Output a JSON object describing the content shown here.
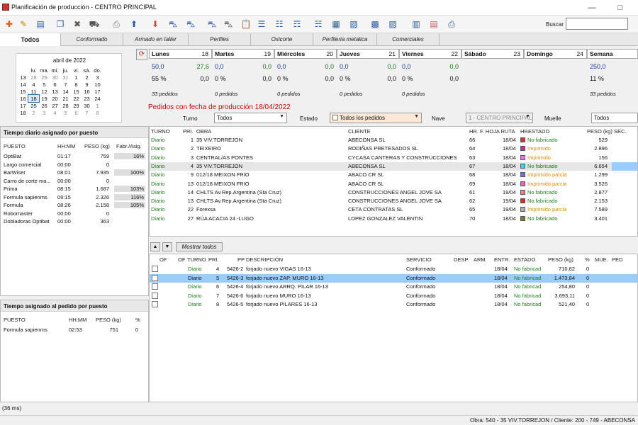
{
  "window": {
    "title": "Planificación de producción - CENTRO PRINCIPAL",
    "minimize": "—",
    "maximize": "□",
    "close": "✕"
  },
  "toolbar": {
    "icons": [
      "add-icon",
      "edit-icon",
      "book-icon",
      "copy-icon",
      "delete-icon",
      "truck-icon",
      "print-icon",
      "up-icon",
      "down-icon",
      "car-add-icon",
      "car-remove-icon",
      "car-cut-icon",
      "car-icon",
      "clipboard-icon",
      "list-icon",
      "list-edit-icon",
      "list-copy-icon",
      "list-new-icon",
      "doc-icon",
      "doc-alt-icon",
      "grid-icon",
      "grid-alt-icon",
      "report-icon",
      "report-alt-icon",
      "report-print-icon"
    ],
    "search_label": "Buscar",
    "search_value": ""
  },
  "tabs": [
    "Todos",
    "Conformado",
    "Armado en taller",
    "Perfiles",
    "Oxicorte",
    "Perfileria metalica",
    "Comerciales"
  ],
  "calendar": {
    "month": "abril de 2022",
    "weekdays": [
      "lu.",
      "ma.",
      "mi.",
      "ju.",
      "vi.",
      "sá.",
      "do."
    ],
    "weeks": [
      [
        "13",
        "28",
        "29",
        "30",
        "31",
        "1",
        "2",
        "3"
      ],
      [
        "14",
        "4",
        "5",
        "6",
        "7",
        "8",
        "9",
        "10"
      ],
      [
        "15",
        "11",
        "12",
        "13",
        "14",
        "15",
        "16",
        "17"
      ],
      [
        "16",
        "18",
        "19",
        "20",
        "21",
        "22",
        "23",
        "24"
      ],
      [
        "17",
        "25",
        "26",
        "27",
        "28",
        "29",
        "30",
        "1"
      ],
      [
        "18",
        "2",
        "3",
        "4",
        "5",
        "6",
        "7",
        "8"
      ]
    ]
  },
  "week": {
    "days": [
      {
        "name": "Lunes",
        "num": "18",
        "weight": "50,0",
        "val": "27,6",
        "extra": "",
        "pct": "55 %",
        "pct_val": "0,0",
        "orders": "33 pedidos"
      },
      {
        "name": "Martes",
        "num": "19",
        "weight": "0,0",
        "val": "0,0",
        "extra": "",
        "pct": "0 %",
        "pct_val": "0,0",
        "orders": "0 pedidos"
      },
      {
        "name": "Miércoles",
        "num": "20",
        "weight": "0,0",
        "val": "0,0",
        "extra": "",
        "pct": "0 %",
        "pct_val": "0,0",
        "orders": "0 pedidos"
      },
      {
        "name": "Jueves",
        "num": "21",
        "weight": "0,0",
        "val": "0,0",
        "extra": "",
        "pct": "0 %",
        "pct_val": "0,0",
        "orders": "0 pedidos"
      },
      {
        "name": "Viernes",
        "num": "22",
        "weight": "0,0",
        "val": "0,0",
        "extra": "",
        "pct": "0 %",
        "pct_val": "0,0",
        "orders": "0 pedidos"
      },
      {
        "name": "Sábado",
        "num": "23",
        "weight": "",
        "val": "",
        "extra": "",
        "pct": "",
        "pct_val": "",
        "orders": ""
      },
      {
        "name": "Domingo",
        "num": "24",
        "weight": "",
        "val": "",
        "extra": "",
        "pct": "",
        "pct_val": "",
        "orders": ""
      },
      {
        "name": "Semana",
        "num": "",
        "weight": "250,0",
        "val": "",
        "extra": "",
        "pct": "11 %",
        "pct_val": "",
        "orders": "33 pedidos"
      }
    ]
  },
  "orders_section": {
    "title": "Pedidos con fecha de producción 18/04/2022",
    "turno_label": "Turno",
    "turno_value": "Todos",
    "estado_label": "Estado",
    "estado_value": "Todos los pedidos",
    "nave_label": "Nave",
    "nave_value": "1 - CENTRO PRINCIPAL",
    "muelle_label": "Muelle",
    "muelle_value": "Todos"
  },
  "colors": {
    "green": "#1c7c1c",
    "orange": "#e08a00",
    "blue": "#1a3d9a",
    "red": "#c00000"
  },
  "orders": {
    "headers": [
      "TURNO",
      "PRI.",
      "OBRA",
      "CLIENTE",
      "HR.",
      "F. HOJA RUTA",
      "HR.",
      "ESTADO",
      "PESO (kg)",
      "SEC."
    ],
    "rows": [
      {
        "turno": "Diario",
        "pri": "1",
        "obra": "35 VIV.TORREJON",
        "cliente": "ABECONSA SL",
        "hr": "66",
        "fecha": "18/04",
        "color": "#e03030",
        "estado": "No fabricado",
        "peso": "529",
        "st": "green"
      },
      {
        "turno": "Diario",
        "pri": "2",
        "obra": "TEIXEIRO",
        "cliente": "RODIÑAS PRETESADOS SL",
        "hr": "64",
        "fecha": "18/04",
        "color": "#e02090",
        "estado": "Imprimido",
        "peso": "2.896",
        "st": "orange"
      },
      {
        "turno": "Diario",
        "pri": "3",
        "obra": "CENTRAL/AS PONTES",
        "cliente": "CYCASA CANTERAS Y CONSTRUCCIONES",
        "hr": "63",
        "fecha": "18/04",
        "color": "#f070f0",
        "estado": "Imprimido",
        "peso": "156",
        "st": "orange"
      },
      {
        "turno": "Diario",
        "pri": "4",
        "obra": "35 VIV.TORREJON",
        "cliente": "ABECONSA SL",
        "hr": "67",
        "fecha": "18/04",
        "color": "#20e0f0",
        "estado": "No fabricado",
        "peso": "6.654",
        "st": "green"
      },
      {
        "turno": "Diario",
        "pri": "9",
        "obra": "012/18 MEIXON FRIO",
        "cliente": "ABACO CR SL",
        "hr": "68",
        "fecha": "18/04",
        "color": "#7070e0",
        "estado": "Imprimido parcia",
        "peso": "1.299",
        "st": "orange"
      },
      {
        "turno": "Diario",
        "pri": "13",
        "obra": "012/18 MEIXON FRIO",
        "cliente": "ABACO CR SL",
        "hr": "69",
        "fecha": "18/04",
        "color": "#f060c0",
        "estado": "Imprimido parcia",
        "peso": "3.526",
        "st": "orange"
      },
      {
        "turno": "Diario",
        "pri": "14",
        "obra": "CHLTS Av.Rep.Argentina (Sta Cruz)",
        "cliente": "CONSTRUCCIONES ANGEL JOVE SA",
        "hr": "61",
        "fecha": "19/04",
        "color": "#f08090",
        "estado": "No fabricado",
        "peso": "2.877",
        "st": "green"
      },
      {
        "turno": "Diario",
        "pri": "13",
        "obra": "CHLTS Av.Rep.Argentina (Sta Cruz)",
        "cliente": "CONSTRUCCIONES ANGEL JOVE SA",
        "hr": "62",
        "fecha": "19/04",
        "color": "#f02020",
        "estado": "No fabricado",
        "peso": "2.153",
        "st": "green"
      },
      {
        "turno": "Diario",
        "pri": "22",
        "obra": "Forexsa",
        "cliente": "CETA CONTRATAS SL",
        "hr": "65",
        "fecha": "19/04",
        "color": "#b0b0b0",
        "estado": "Imprimido parcia",
        "peso": "7.589",
        "st": "orange"
      },
      {
        "turno": "Diario",
        "pri": "27",
        "obra": "RÚA ACACIA 24 -LUGO",
        "cliente": "LOPEZ GONZALEZ VALENTIN",
        "hr": "70",
        "fecha": "18/04",
        "color": "#808020",
        "estado": "No fabricado",
        "peso": "3.401",
        "st": "green"
      }
    ]
  },
  "left_top": {
    "title": "Tiempo diario asignado por puesto",
    "headers": [
      "PUESTO",
      "HH:MM",
      "PESO (kg)",
      "Fabr./Asig."
    ],
    "rows": [
      {
        "puesto": "OptiBat",
        "hh": "01:17",
        "peso": "759",
        "pct": "16%"
      },
      {
        "puesto": "Largo comercial",
        "hh": "00:00",
        "peso": "0",
        "pct": ""
      },
      {
        "puesto": "BarWiser",
        "hh": "08:01",
        "peso": "7.935",
        "pct": "100%"
      },
      {
        "puesto": "Carro de corte ma...",
        "hh": "00:00",
        "peso": "0",
        "pct": ""
      },
      {
        "puesto": "Prima",
        "hh": "08:15",
        "peso": "1.687",
        "pct": "103%"
      },
      {
        "puesto": "Formula sapienms",
        "hh": "09:15",
        "peso": "2.326",
        "pct": "116%"
      },
      {
        "puesto": "Formula",
        "hh": "08:26",
        "peso": "2.158",
        "pct": "105%"
      },
      {
        "puesto": "Robomaster",
        "hh": "00:00",
        "peso": "0",
        "pct": ""
      },
      {
        "puesto": "Dobladoras Optibat",
        "hh": "00:00",
        "peso": "363",
        "pct": ""
      }
    ]
  },
  "left_bottom": {
    "title": "Tiempo asignado al pedido por puesto",
    "headers": [
      "PUESTO",
      "HH:MM",
      "PESO (kg)",
      "%"
    ],
    "rows": [
      {
        "puesto": "Formula sapienms",
        "hh": "02:53",
        "peso": "751",
        "pct": "0"
      }
    ]
  },
  "detail": {
    "up": "▲",
    "down": "▼",
    "mostrar": "Mostrar todos",
    "headers": [
      "OF",
      "OF",
      "TURNO",
      "PRI.",
      "PP",
      "DESCRIPCIÓN",
      "SERVICIO",
      "DESP.",
      "ARM.",
      "ENTR.",
      "ESTADO",
      "PESO (kg)",
      "%",
      "MUE.",
      "PED"
    ],
    "rows": [
      {
        "turno": "Diario",
        "pri": "4",
        "pp": "5426-2",
        "desc": "forjado nuevo VIGAS 16-13",
        "servicio": "Conformado",
        "entr": "18/04",
        "estado": "No fabricad",
        "peso": "710,62",
        "pct": "0"
      },
      {
        "turno": "Diario",
        "pri": "5",
        "pp": "5426-3",
        "desc": "forjado nuevo ZAP. MURO 16-13",
        "servicio": "Conformado",
        "entr": "18/04",
        "estado": "No fabricad",
        "peso": "1.473,84",
        "pct": "0"
      },
      {
        "turno": "Diario",
        "pri": "6",
        "pp": "5426-4",
        "desc": "forjado nuevo ARRQ. PILAR 16-13",
        "servicio": "Conformado",
        "entr": "18/04",
        "estado": "No fabricad",
        "peso": "254,80",
        "pct": "0"
      },
      {
        "turno": "Diario",
        "pri": "7",
        "pp": "5426-6",
        "desc": "forjado nuevo MURO 16-13",
        "servicio": "Conformado",
        "entr": "18/04",
        "estado": "No fabricad",
        "peso": "3.693,11",
        "pct": "0"
      },
      {
        "turno": "Diario",
        "pri": "8",
        "pp": "5426-5",
        "desc": "forjado nuevo PILARES 16-13",
        "servicio": "Conformado",
        "entr": "18/04",
        "estado": "No fabricad",
        "peso": "521,40",
        "pct": "0"
      }
    ]
  },
  "status": {
    "time": "(36 ms)",
    "info": "Obra: 540 - 35 VIV.TORREJON / Cliente: 200 - 749 - ABECONSA"
  }
}
